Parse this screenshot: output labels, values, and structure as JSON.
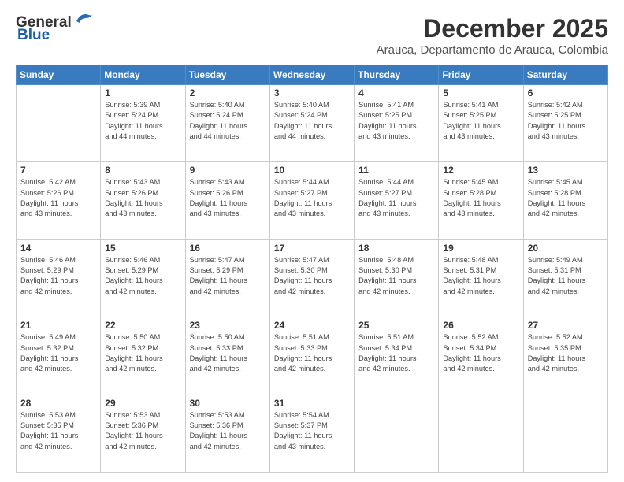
{
  "header": {
    "logo_general": "General",
    "logo_blue": "Blue",
    "month_title": "December 2025",
    "location": "Arauca, Departamento de Arauca, Colombia"
  },
  "days": [
    "Sunday",
    "Monday",
    "Tuesday",
    "Wednesday",
    "Thursday",
    "Friday",
    "Saturday"
  ],
  "weeks": [
    [
      {
        "date": "",
        "sunrise": "",
        "sunset": "",
        "daylight": ""
      },
      {
        "date": "1",
        "sunrise": "Sunrise: 5:39 AM",
        "sunset": "Sunset: 5:24 PM",
        "daylight": "Daylight: 11 hours and 44 minutes."
      },
      {
        "date": "2",
        "sunrise": "Sunrise: 5:40 AM",
        "sunset": "Sunset: 5:24 PM",
        "daylight": "Daylight: 11 hours and 44 minutes."
      },
      {
        "date": "3",
        "sunrise": "Sunrise: 5:40 AM",
        "sunset": "Sunset: 5:24 PM",
        "daylight": "Daylight: 11 hours and 44 minutes."
      },
      {
        "date": "4",
        "sunrise": "Sunrise: 5:41 AM",
        "sunset": "Sunset: 5:25 PM",
        "daylight": "Daylight: 11 hours and 43 minutes."
      },
      {
        "date": "5",
        "sunrise": "Sunrise: 5:41 AM",
        "sunset": "Sunset: 5:25 PM",
        "daylight": "Daylight: 11 hours and 43 minutes."
      },
      {
        "date": "6",
        "sunrise": "Sunrise: 5:42 AM",
        "sunset": "Sunset: 5:25 PM",
        "daylight": "Daylight: 11 hours and 43 minutes."
      }
    ],
    [
      {
        "date": "7",
        "sunrise": "Sunrise: 5:42 AM",
        "sunset": "Sunset: 5:26 PM",
        "daylight": "Daylight: 11 hours and 43 minutes."
      },
      {
        "date": "8",
        "sunrise": "Sunrise: 5:43 AM",
        "sunset": "Sunset: 5:26 PM",
        "daylight": "Daylight: 11 hours and 43 minutes."
      },
      {
        "date": "9",
        "sunrise": "Sunrise: 5:43 AM",
        "sunset": "Sunset: 5:26 PM",
        "daylight": "Daylight: 11 hours and 43 minutes."
      },
      {
        "date": "10",
        "sunrise": "Sunrise: 5:44 AM",
        "sunset": "Sunset: 5:27 PM",
        "daylight": "Daylight: 11 hours and 43 minutes."
      },
      {
        "date": "11",
        "sunrise": "Sunrise: 5:44 AM",
        "sunset": "Sunset: 5:27 PM",
        "daylight": "Daylight: 11 hours and 43 minutes."
      },
      {
        "date": "12",
        "sunrise": "Sunrise: 5:45 AM",
        "sunset": "Sunset: 5:28 PM",
        "daylight": "Daylight: 11 hours and 43 minutes."
      },
      {
        "date": "13",
        "sunrise": "Sunrise: 5:45 AM",
        "sunset": "Sunset: 5:28 PM",
        "daylight": "Daylight: 11 hours and 42 minutes."
      }
    ],
    [
      {
        "date": "14",
        "sunrise": "Sunrise: 5:46 AM",
        "sunset": "Sunset: 5:29 PM",
        "daylight": "Daylight: 11 hours and 42 minutes."
      },
      {
        "date": "15",
        "sunrise": "Sunrise: 5:46 AM",
        "sunset": "Sunset: 5:29 PM",
        "daylight": "Daylight: 11 hours and 42 minutes."
      },
      {
        "date": "16",
        "sunrise": "Sunrise: 5:47 AM",
        "sunset": "Sunset: 5:29 PM",
        "daylight": "Daylight: 11 hours and 42 minutes."
      },
      {
        "date": "17",
        "sunrise": "Sunrise: 5:47 AM",
        "sunset": "Sunset: 5:30 PM",
        "daylight": "Daylight: 11 hours and 42 minutes."
      },
      {
        "date": "18",
        "sunrise": "Sunrise: 5:48 AM",
        "sunset": "Sunset: 5:30 PM",
        "daylight": "Daylight: 11 hours and 42 minutes."
      },
      {
        "date": "19",
        "sunrise": "Sunrise: 5:48 AM",
        "sunset": "Sunset: 5:31 PM",
        "daylight": "Daylight: 11 hours and 42 minutes."
      },
      {
        "date": "20",
        "sunrise": "Sunrise: 5:49 AM",
        "sunset": "Sunset: 5:31 PM",
        "daylight": "Daylight: 11 hours and 42 minutes."
      }
    ],
    [
      {
        "date": "21",
        "sunrise": "Sunrise: 5:49 AM",
        "sunset": "Sunset: 5:32 PM",
        "daylight": "Daylight: 11 hours and 42 minutes."
      },
      {
        "date": "22",
        "sunrise": "Sunrise: 5:50 AM",
        "sunset": "Sunset: 5:32 PM",
        "daylight": "Daylight: 11 hours and 42 minutes."
      },
      {
        "date": "23",
        "sunrise": "Sunrise: 5:50 AM",
        "sunset": "Sunset: 5:33 PM",
        "daylight": "Daylight: 11 hours and 42 minutes."
      },
      {
        "date": "24",
        "sunrise": "Sunrise: 5:51 AM",
        "sunset": "Sunset: 5:33 PM",
        "daylight": "Daylight: 11 hours and 42 minutes."
      },
      {
        "date": "25",
        "sunrise": "Sunrise: 5:51 AM",
        "sunset": "Sunset: 5:34 PM",
        "daylight": "Daylight: 11 hours and 42 minutes."
      },
      {
        "date": "26",
        "sunrise": "Sunrise: 5:52 AM",
        "sunset": "Sunset: 5:34 PM",
        "daylight": "Daylight: 11 hours and 42 minutes."
      },
      {
        "date": "27",
        "sunrise": "Sunrise: 5:52 AM",
        "sunset": "Sunset: 5:35 PM",
        "daylight": "Daylight: 11 hours and 42 minutes."
      }
    ],
    [
      {
        "date": "28",
        "sunrise": "Sunrise: 5:53 AM",
        "sunset": "Sunset: 5:35 PM",
        "daylight": "Daylight: 11 hours and 42 minutes."
      },
      {
        "date": "29",
        "sunrise": "Sunrise: 5:53 AM",
        "sunset": "Sunset: 5:36 PM",
        "daylight": "Daylight: 11 hours and 42 minutes."
      },
      {
        "date": "30",
        "sunrise": "Sunrise: 5:53 AM",
        "sunset": "Sunset: 5:36 PM",
        "daylight": "Daylight: 11 hours and 42 minutes."
      },
      {
        "date": "31",
        "sunrise": "Sunrise: 5:54 AM",
        "sunset": "Sunset: 5:37 PM",
        "daylight": "Daylight: 11 hours and 43 minutes."
      },
      {
        "date": "",
        "sunrise": "",
        "sunset": "",
        "daylight": ""
      },
      {
        "date": "",
        "sunrise": "",
        "sunset": "",
        "daylight": ""
      },
      {
        "date": "",
        "sunrise": "",
        "sunset": "",
        "daylight": ""
      }
    ]
  ]
}
